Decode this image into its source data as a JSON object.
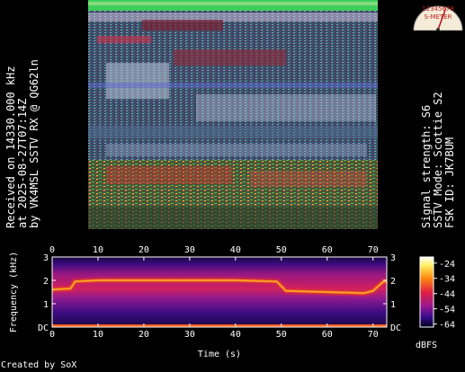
{
  "left_info": {
    "line1": "Received on  14330.000 kHz",
    "line2": "at 2025-08-27T07:14Z",
    "line3": "by VK4MSL SSTV RX @ QG62ln"
  },
  "right_info": {
    "line1": "Signal strength: S6",
    "line2": "SSTV Mode: Scottie S2",
    "line3": "FSK ID: JK7BUM"
  },
  "meter": {
    "scale_text": "12345678",
    "label": "S-METER",
    "level": "S6"
  },
  "spectrogram": {
    "x_ticks": [
      "0",
      "10",
      "20",
      "30",
      "40",
      "50",
      "60",
      "70"
    ],
    "x_values": [
      0,
      10,
      20,
      30,
      40,
      50,
      60,
      70
    ],
    "x_max": 73,
    "y_ticks_left": [
      "DC",
      "1",
      "2",
      "3"
    ],
    "y_ticks_right": [
      "DC",
      "1",
      "2",
      "3"
    ],
    "y_values": [
      0,
      1,
      2,
      3
    ],
    "y_max": 3,
    "xlabel": "Time (s)",
    "ylabel": "Frequency (kHz)",
    "colorbar_ticks": [
      "-24",
      "-34",
      "-44",
      "-54",
      "-64"
    ],
    "colorbar_values": [
      -24,
      -34,
      -44,
      -54,
      -64
    ],
    "colorbar_range": [
      -66,
      -20
    ],
    "colorbar_unit": "dBFS",
    "tone_track": [
      [
        0,
        1.6
      ],
      [
        4,
        1.65
      ],
      [
        5,
        1.95
      ],
      [
        10,
        2.0
      ],
      [
        20,
        2.0
      ],
      [
        30,
        2.0
      ],
      [
        40,
        2.0
      ],
      [
        49,
        1.95
      ],
      [
        51,
        1.55
      ],
      [
        60,
        1.5
      ],
      [
        68,
        1.45
      ],
      [
        70,
        1.55
      ],
      [
        72,
        1.9
      ],
      [
        73,
        2.0
      ]
    ]
  },
  "credit": "Created by SoX",
  "colors": {
    "background": "#000000",
    "text": "#ffffff",
    "spectrum_bg": "#2a0a5c",
    "tone": "#ff9a20"
  }
}
